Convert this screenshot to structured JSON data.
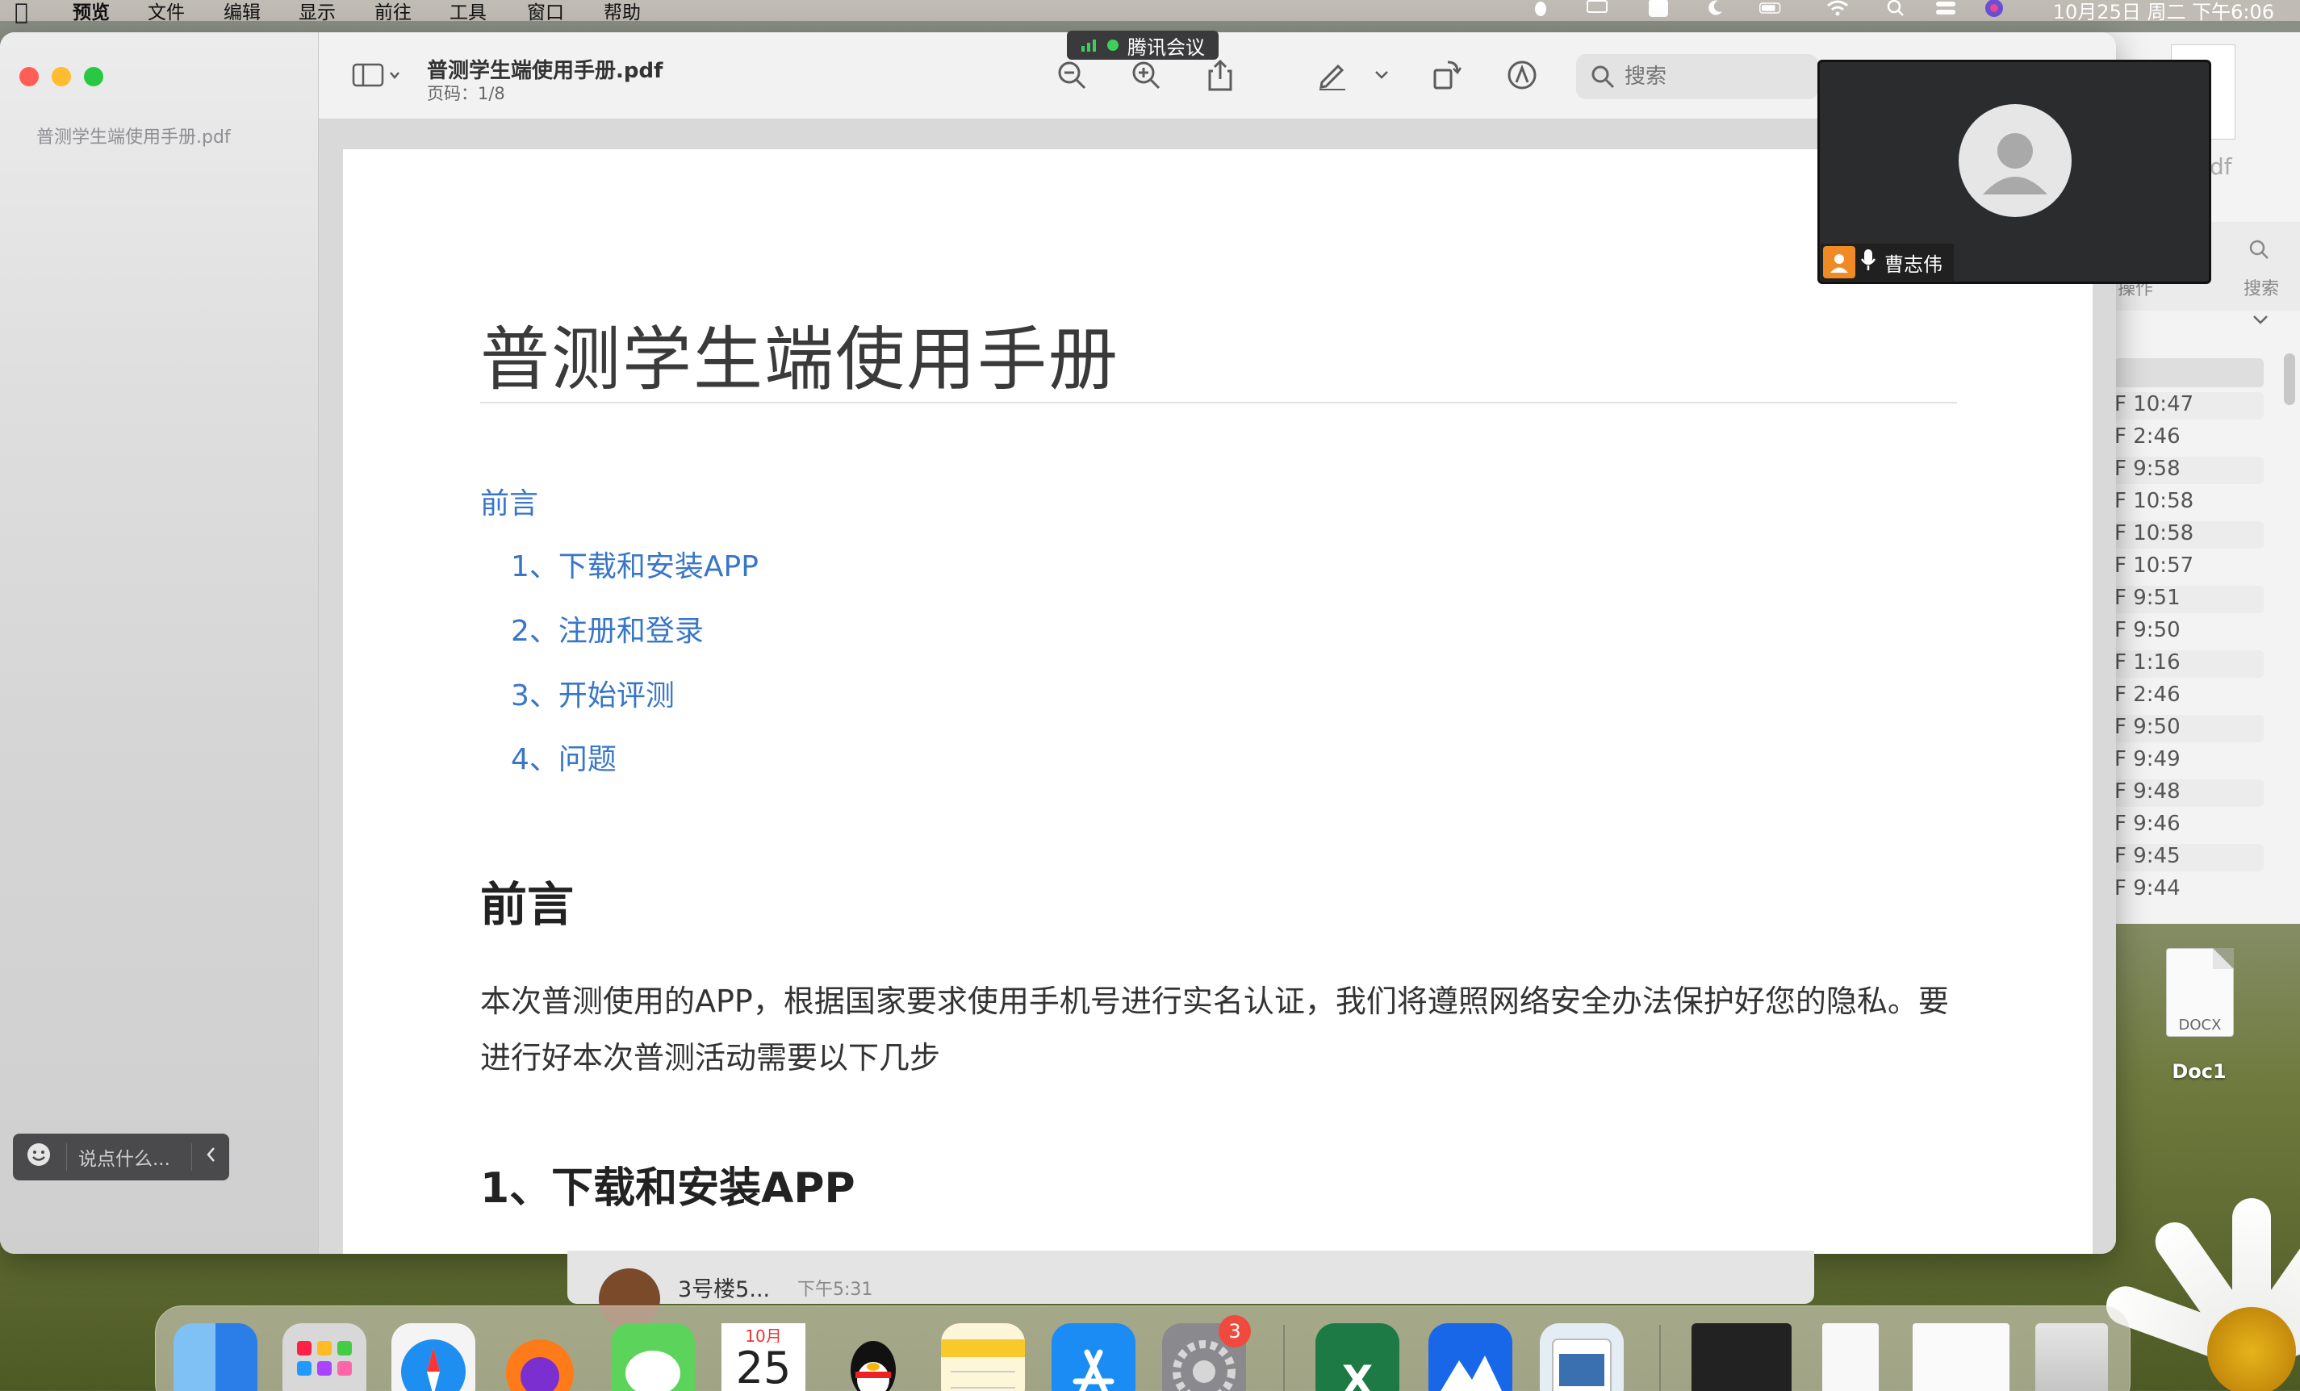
{
  "menubar": {
    "app": "预览",
    "items": [
      "文件",
      "编辑",
      "显示",
      "前往",
      "工具",
      "窗口",
      "帮助"
    ],
    "clock": "10月25日 周二 下午6:06"
  },
  "window": {
    "sidebar_file": "普测学生端使用手册.pdf",
    "doc_title": "普测学生端使用手册.pdf",
    "page_info": "页码：1/8",
    "search_placeholder": "搜索"
  },
  "document": {
    "title": "普测学生端使用手册",
    "toc": [
      "前言",
      "1、下载和安装APP",
      "2、注册和登录",
      "3、开始评测",
      "4、问题"
    ],
    "section_preface_heading": "前言",
    "preface_text": "本次普测使用的APP，根据国家要求使用手机号进行实名认证，我们将遵照网络安全办法保护好您的隐私。要进行好本次普测活动需要以下几步",
    "section1_heading": "1、下载和安装APP"
  },
  "meeting": {
    "app_tab": "腾讯会议",
    "participant_name": "曹志伟",
    "chat_placeholder": "说点什么..."
  },
  "background_window": {
    "toolbar_label_left": "操作",
    "toolbar_label_right": "搜索",
    "thumb_suffix": "df",
    "times": [
      "F 10:47",
      "F 2:46",
      "F 9:58",
      "F 10:58",
      "F 10:58",
      "F 10:57",
      "F 9:51",
      "F 9:50",
      "F 1:16",
      "F 2:46",
      "F 9:50",
      "F 9:49",
      "F 9:48",
      "F 9:46",
      "F 9:45",
      "F 9:44"
    ]
  },
  "desktop": {
    "file_ext": "DOCX",
    "file_name": "Doc1"
  },
  "notification": {
    "title": "3号楼5...",
    "time": "下午5:31"
  },
  "dock": {
    "calendar_month": "10月",
    "calendar_day": "25",
    "settings_badge": "3",
    "excel_letter": "X"
  },
  "colors": {
    "link": "#3876c7",
    "close": "#ff5f57",
    "minimize": "#febc2e",
    "zoom": "#28c840",
    "meeting_green": "#3ecf5a",
    "badge_red": "#f04a3e"
  }
}
